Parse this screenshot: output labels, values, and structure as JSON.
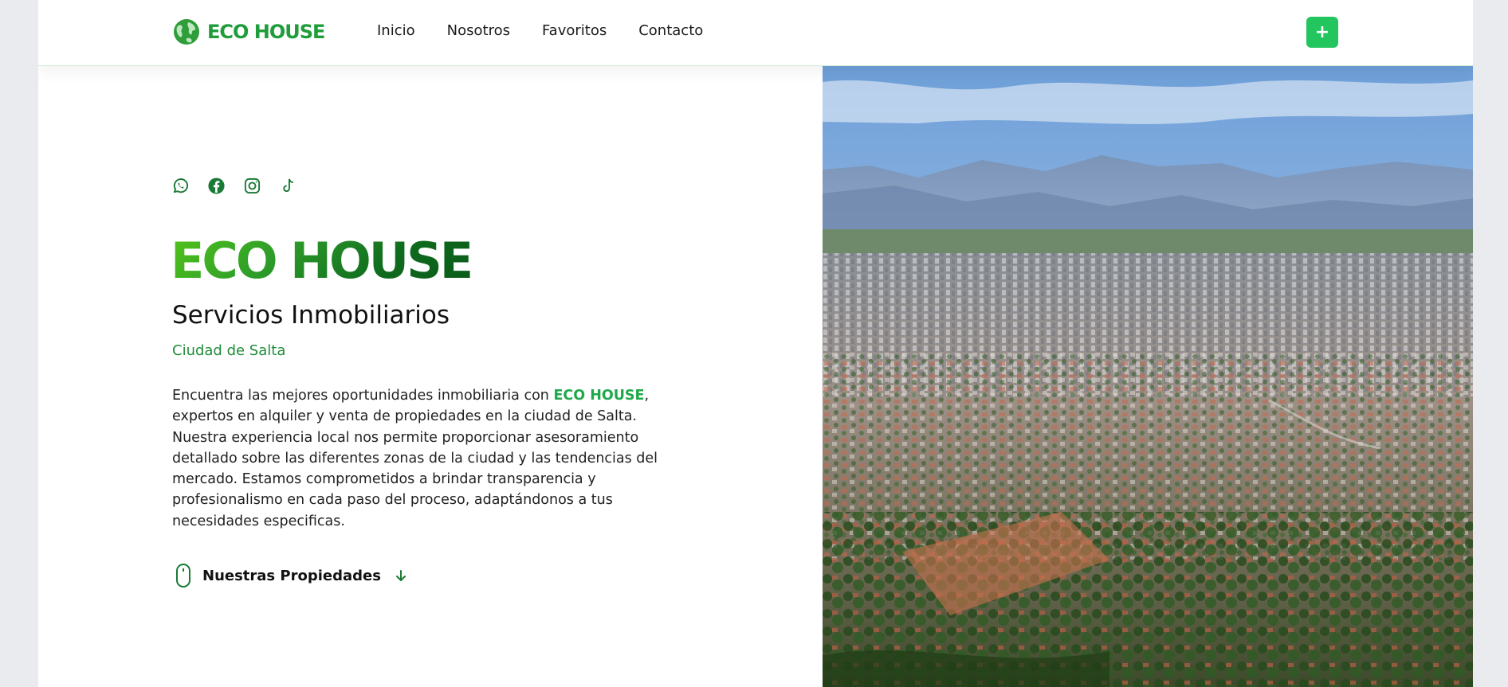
{
  "brand": {
    "name": "ECO HOUSE"
  },
  "nav": {
    "items": [
      "Inicio",
      "Nosotros",
      "Favoritos",
      "Contacto"
    ]
  },
  "header": {
    "add_button_label": "+"
  },
  "social": [
    "whatsapp-icon",
    "facebook-icon",
    "instagram-icon",
    "tiktok-icon"
  ],
  "hero": {
    "logo": "ECO HOUSE",
    "title": "Servicios Inmobiliarios",
    "subtitle": "Ciudad de Salta",
    "description_before": "Encuentra las mejores oportunidades inmobiliaria con ",
    "description_highlight": "ECO HOUSE",
    "description_after": ", expertos en alquiler y venta de propiedades en la ciudad de Salta. Nuestra experiencia local nos permite proporcionar asesoramiento detallado sobre las diferentes zonas de la ciudad y las tendencias del mercado. Estamos comprometidos a brindar transparencia y profesionalismo en cada paso del proceso, adaptándonos a tus necesidades especificas.",
    "cta_label": "Nuestras Propiedades"
  },
  "colors": {
    "accent": "#22c55e",
    "brand_green": "#1f9d3a",
    "subtitle_green": "#1f8c3a"
  }
}
